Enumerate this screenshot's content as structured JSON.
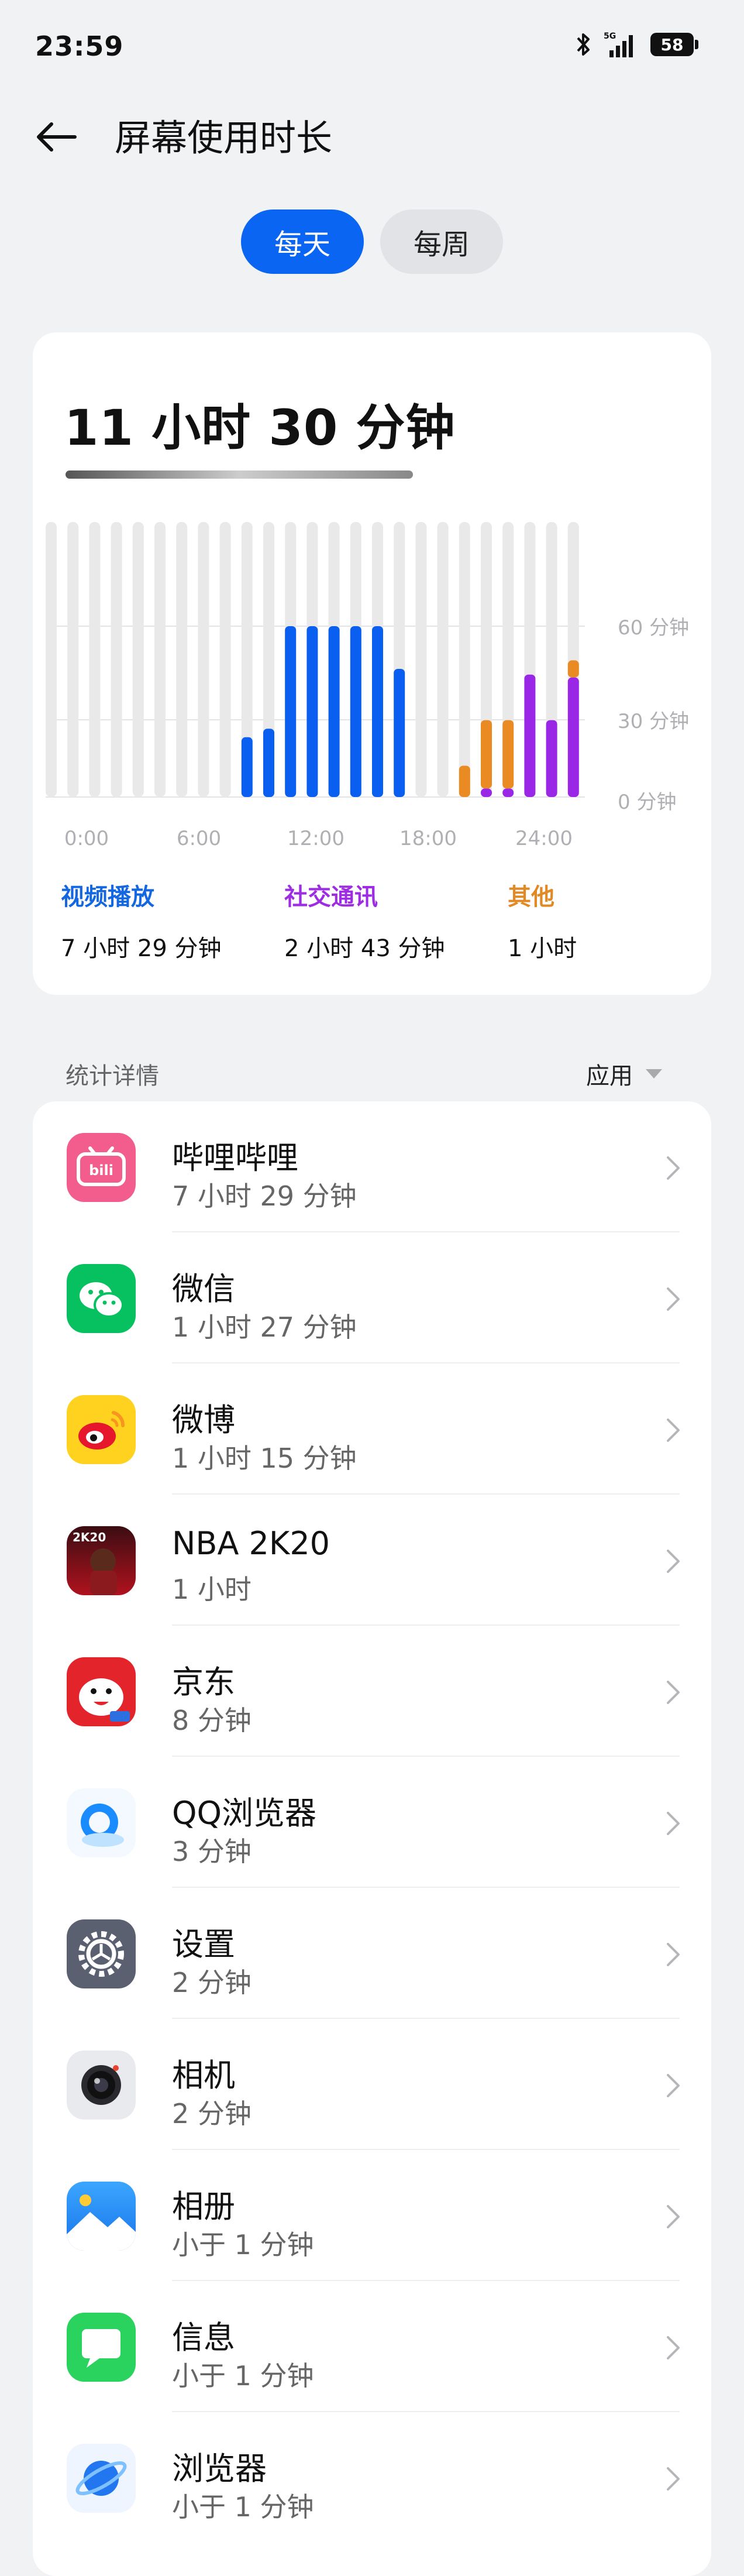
{
  "status_bar": {
    "time": "23:59",
    "battery": "58",
    "icons": [
      "bluetooth-icon",
      "5g-signal-icon",
      "battery-icon"
    ]
  },
  "header": {
    "title": "屏幕使用时长"
  },
  "segments": {
    "day": "每天",
    "week": "每周",
    "selected": "day"
  },
  "summary": {
    "total": "11 小时 30 分钟"
  },
  "chart_data": {
    "type": "bar",
    "x_tick_labels": [
      "0:00",
      "6:00",
      "12:00",
      "18:00",
      "24:00"
    ],
    "y_tick_labels": [
      "60 分钟",
      "30 分钟",
      "0 分钟"
    ],
    "ylim": [
      0,
      60
    ],
    "categories": [
      "0:00",
      "1:00",
      "2:00",
      "3:00",
      "4:00",
      "5:00",
      "6:00",
      "7:00",
      "8:00",
      "9:00",
      "10:00",
      "11:00",
      "12:00",
      "13:00",
      "14:00",
      "15:00",
      "16:00",
      "17:00",
      "18:00",
      "19:00",
      "20:00",
      "21:00",
      "22:00",
      "23:00"
    ],
    "series": [
      {
        "name": "视频播放",
        "color": "#0a5ff0",
        "values": [
          0,
          0,
          0,
          0,
          0,
          0,
          0,
          0,
          21,
          24,
          60,
          60,
          60,
          60,
          60,
          45,
          0,
          0,
          0,
          0,
          0,
          0,
          0,
          0
        ]
      },
      {
        "name": "社交通讯",
        "color": "#9b27e6",
        "values": [
          0,
          0,
          0,
          0,
          0,
          0,
          0,
          0,
          0,
          0,
          0,
          0,
          0,
          0,
          0,
          0,
          0,
          0,
          0,
          3,
          3,
          43,
          27,
          42
        ]
      },
      {
        "name": "其他",
        "color": "#ea8a22",
        "values": [
          0,
          0,
          0,
          0,
          0,
          0,
          0,
          0,
          0,
          0,
          0,
          0,
          0,
          0,
          0,
          0,
          0,
          0,
          11,
          24,
          24,
          0,
          0,
          6
        ]
      }
    ],
    "background_bars": 25,
    "bar_bg_color": "#e9e9ea"
  },
  "legend": [
    {
      "name": "视频播放",
      "value": "7 小时 29 分钟"
    },
    {
      "name": "社交通讯",
      "value": "2 小时 43 分钟"
    },
    {
      "name": "其他",
      "value": "1 小时"
    }
  ],
  "section": {
    "title": "统计详情",
    "filter": "应用"
  },
  "apps": [
    {
      "name": "哔哩哔哩",
      "time": "7 小时 29 分钟",
      "icon": "bilibili-icon"
    },
    {
      "name": "微信",
      "time": "1 小时 27 分钟",
      "icon": "wechat-icon"
    },
    {
      "name": "微博",
      "time": "1 小时 15 分钟",
      "icon": "weibo-icon"
    },
    {
      "name": "NBA 2K20",
      "time": "1 小时",
      "icon": "nba2k20-icon"
    },
    {
      "name": "京东",
      "time": "8 分钟",
      "icon": "jd-icon"
    },
    {
      "name": "QQ浏览器",
      "time": "3 分钟",
      "icon": "qq-browser-icon"
    },
    {
      "name": "设置",
      "time": "2 分钟",
      "icon": "settings-gear-icon"
    },
    {
      "name": "相机",
      "time": "2 分钟",
      "icon": "camera-icon"
    },
    {
      "name": "相册",
      "time": "小于 1 分钟",
      "icon": "gallery-icon"
    },
    {
      "name": "信息",
      "time": "小于 1 分钟",
      "icon": "messages-icon"
    },
    {
      "name": "浏览器",
      "time": "小于 1 分钟",
      "icon": "browser-icon"
    }
  ]
}
